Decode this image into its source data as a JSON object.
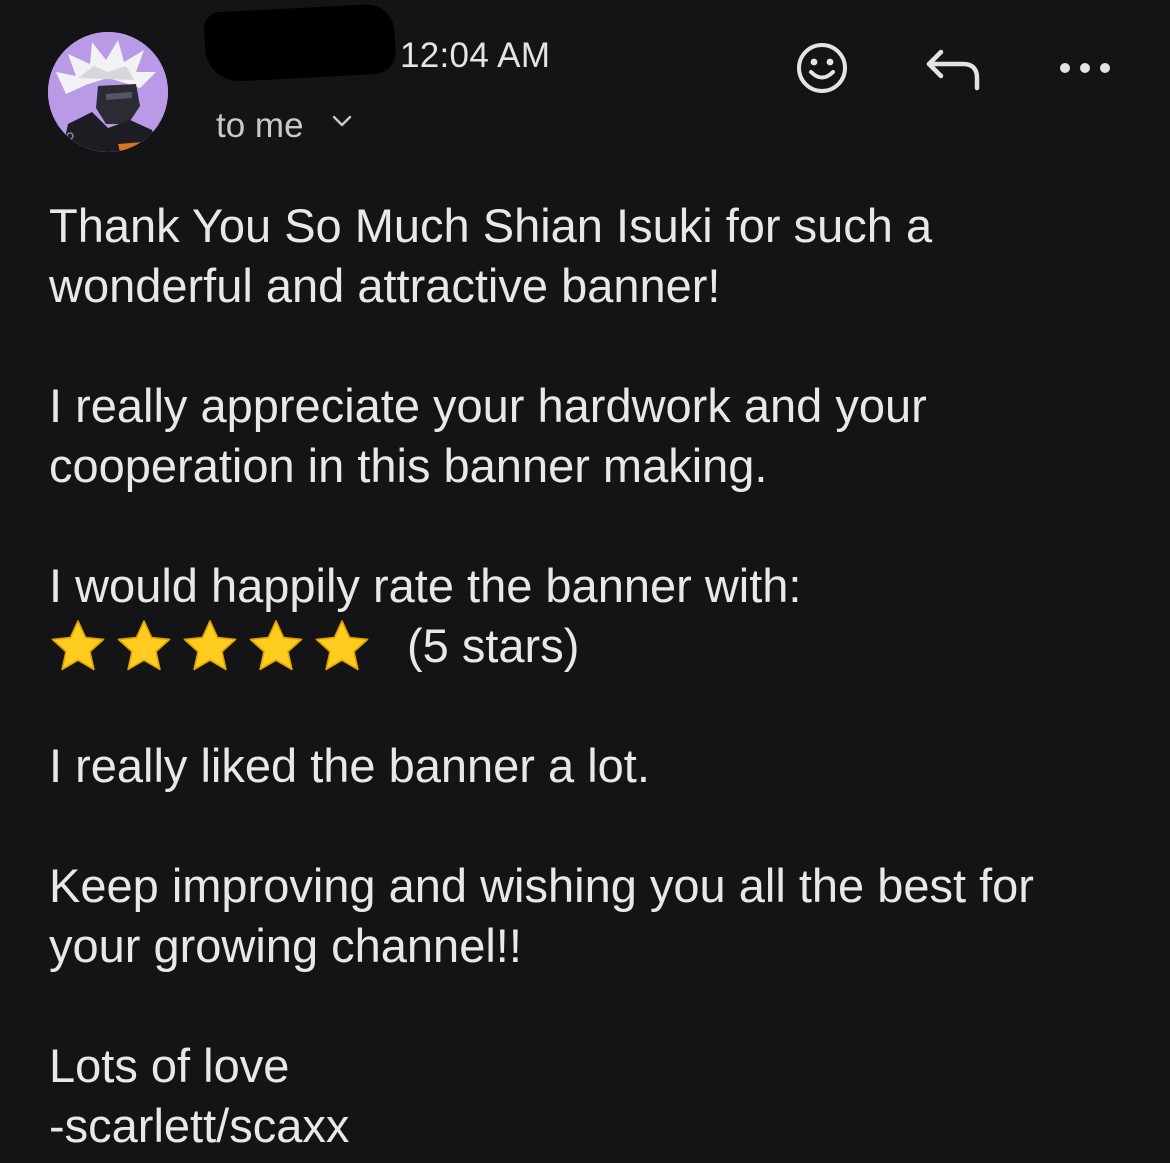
{
  "header": {
    "time": "12:04 AM",
    "recipient_label": "to me",
    "icons": {
      "avatar": "avatar-image",
      "redaction": "redacted-sender-name",
      "emoji": "emoji-smile-icon",
      "reply": "reply-arrow-icon",
      "more": "more-horizontal-icon",
      "recipient_toggle": "chevron-down-icon"
    }
  },
  "message": {
    "p1": [
      "Thank You So Much Shian Isuki for such a",
      "wonderful and attractive banner!"
    ],
    "p2": [
      "I really appreciate your hardwork and your",
      "cooperation in this banner making."
    ],
    "p3": "I would happily rate the banner with:",
    "rating": {
      "stars": 5,
      "max": 5,
      "label": "(5 stars)"
    },
    "p4": "I really liked the banner a lot.",
    "p5": [
      "Keep improving and wishing you all the best for",
      "your growing channel!!"
    ],
    "p6": [
      "Lots of love",
      "-scarlett/scaxx"
    ]
  },
  "colors": {
    "background": "#141416",
    "text": "#e8e8ea",
    "secondary_text": "#c9c9cc",
    "star": "#ffcc1f",
    "avatar_bg": "#b99ae6"
  }
}
